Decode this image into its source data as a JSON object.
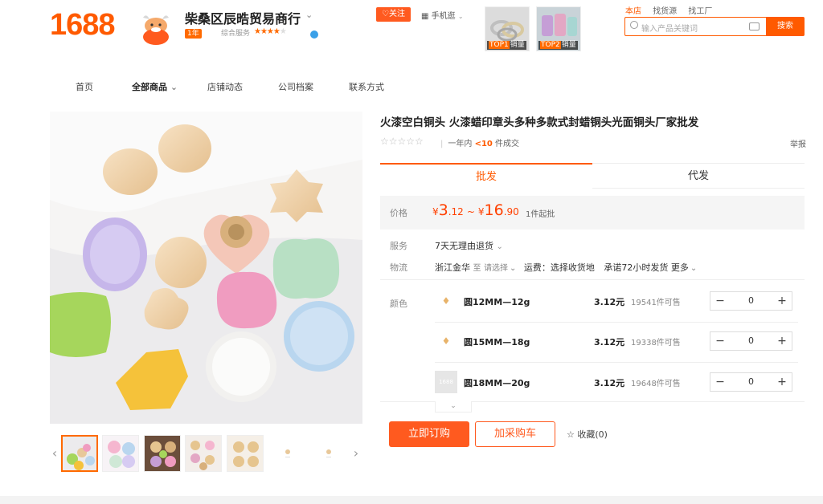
{
  "header": {
    "logo": "1688",
    "shop_name": "柴桑区辰晧贸易商行",
    "shop_year": "1年",
    "score_label": "综合服务",
    "stars_on": "★★★★",
    "stars_off": "★",
    "follow_label": "♡关注",
    "mobile_label": "手机逛",
    "top_products": [
      {
        "rank": "TOP1",
        "tag": "销量"
      },
      {
        "rank": "TOP2",
        "tag": "销量"
      }
    ],
    "search": {
      "tabs": [
        "本店",
        "找货源",
        "找工厂"
      ],
      "placeholder": "输入产品关键词",
      "button_label": "搜索"
    }
  },
  "nav": {
    "items": [
      "首页",
      "全部商品",
      "店铺动态",
      "公司档案",
      "联系方式"
    ]
  },
  "product": {
    "title": "火漆空白铜头 火漆蜡印章头多种多款式封蜡铜头光面铜头厂家批发",
    "rating": "☆☆☆☆☆",
    "sales_prefix": "一年内",
    "sales_value": "<10",
    "sales_suffix": "件成交",
    "report_label": "举报",
    "tabs": {
      "wholesale": "批发",
      "dropship": "代发"
    },
    "price": {
      "label": "价格",
      "currency": "¥",
      "low_int": "3",
      "low_dec": ".12",
      "separator": "~",
      "high_int": "16",
      "high_dec": ".90",
      "moq": "1件起批"
    },
    "service": {
      "label": "服务",
      "value": "7天无理由退货"
    },
    "logistics": {
      "label": "物流",
      "origin": "浙江金华",
      "to": "至",
      "select": "请选择",
      "freight": "运费：选择收货地",
      "promise": "承诺72小时发货",
      "more": "更多"
    },
    "color": {
      "label": "颜色",
      "options": [
        {
          "name": "圆12MM—12g",
          "price": "3.12元",
          "stock": "19541件可售",
          "qty": "0"
        },
        {
          "name": "圆15MM—18g",
          "price": "3.12元",
          "stock": "19338件可售",
          "qty": "0"
        },
        {
          "name": "圆18MM—20g",
          "price": "3.12元",
          "stock": "19648件可售",
          "qty": "0",
          "placeholder_text": "1688"
        }
      ]
    },
    "actions": {
      "buy": "立即订购",
      "cart": "加采购车",
      "favorite": "收藏(0)"
    }
  },
  "colors": {
    "brand": "#ff5a00",
    "price": "#ff4000"
  }
}
